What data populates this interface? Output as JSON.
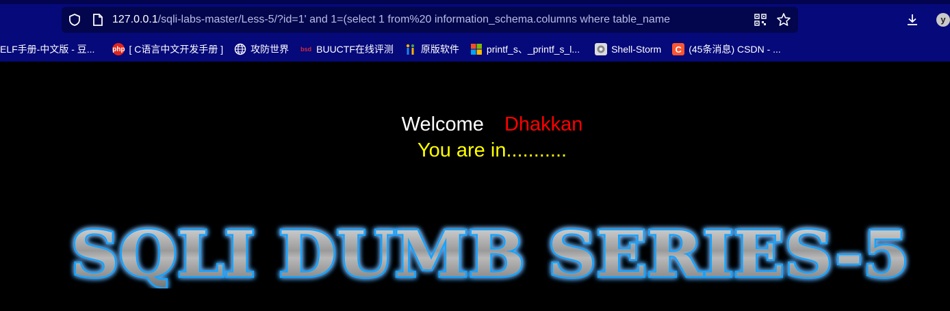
{
  "browser": {
    "url_host": "127.0.0.1",
    "url_path": "/sqli-labs-master/Less-5/?id=1' and 1=(select 1 from%20 information_schema.columns where table_name",
    "profile_initial": "y"
  },
  "bookmarks": [
    {
      "label": "ELF手册-中文版 - 豆...",
      "icon": "none"
    },
    {
      "label": "[ C语言中文开发手册 ]",
      "icon": "php-icon"
    },
    {
      "label": "攻防世界",
      "icon": "globe-icon"
    },
    {
      "label": "BUUCTF在线评测",
      "icon": "buuctf-icon"
    },
    {
      "label": "原版软件",
      "icon": "msdn-icon"
    },
    {
      "label": "printf_s、_printf_s_l...",
      "icon": "microsoft-icon"
    },
    {
      "label": "Shell-Storm",
      "icon": "shellstorm-icon"
    },
    {
      "label": "(45条消息) CSDN - ...",
      "icon": "csdn-icon"
    }
  ],
  "page": {
    "welcome": "Welcome",
    "name": "Dhakkan",
    "status": "You are in...........",
    "banner_text": "SQLI DUMB SERIES-5"
  },
  "colors": {
    "chrome_bg": "#06097a",
    "welcome": "#ffffff",
    "name": "#ff0000",
    "status": "#ffff00",
    "banner_glow": "#1aa9ff"
  }
}
